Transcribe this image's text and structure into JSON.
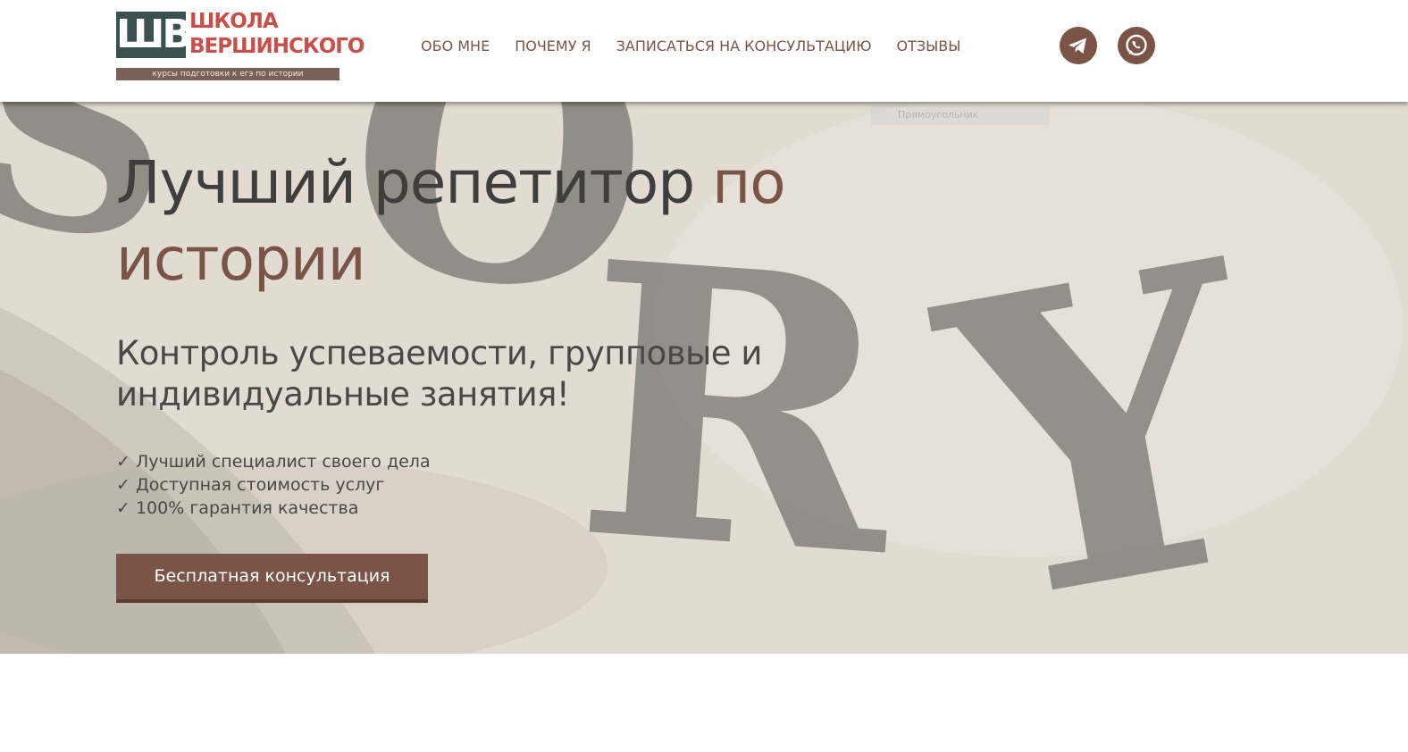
{
  "header": {
    "logo": {
      "mark": "ШВ",
      "name_line1": "школа",
      "name_line2": "вершинского",
      "tagline": "курсы подготовки к егэ по истории"
    },
    "nav": [
      {
        "label": "ОБО МНЕ"
      },
      {
        "label": "ПОЧЕМУ Я"
      },
      {
        "label": "ЗАПИСАТЬСЯ НА КОНСУЛЬТАЦИЮ"
      },
      {
        "label": "ОТЗЫВЫ"
      }
    ],
    "social": [
      {
        "icon": "telegram-icon"
      },
      {
        "icon": "whatsapp-icon"
      }
    ]
  },
  "hero": {
    "background_word": "ISTORY",
    "ghost_label": "Прямоугольник",
    "title_main": "Лучший репетитор ",
    "title_accent": "по истории",
    "subtitle": "Контроль успеваемости, групповые и индивидуальные занятия!",
    "benefits": [
      "✓ Лучший специалист своего дела",
      "✓ Доступная стоимость услуг",
      "✓ 100% гарантия качества"
    ],
    "cta_label": "Бесплатная консультация"
  },
  "colors": {
    "accent": "#7a5547",
    "logo_red": "#c8504a",
    "logo_dark": "#3b5150",
    "text_dark": "#3e3e3c"
  }
}
